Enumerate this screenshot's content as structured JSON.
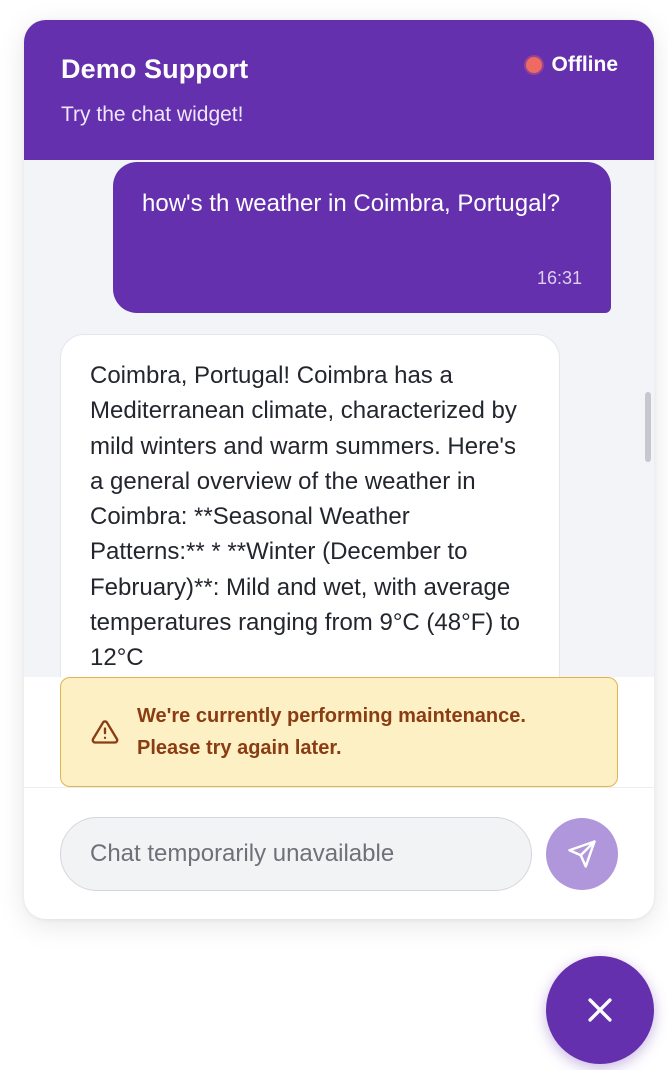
{
  "header": {
    "title": "Demo Support",
    "subtitle": "Try the chat widget!",
    "status": "Offline",
    "status_color": "#ee6a63"
  },
  "messages": [
    {
      "sender": "user",
      "text": "how's th weather in Coimbra, Portugal?",
      "time": "16:31"
    },
    {
      "sender": "bot",
      "text": "Coimbra, Portugal! Coimbra has a Mediterranean climate, characterized by mild winters and warm summers. Here's a general overview of the weather in Coimbra: **Seasonal Weather Patterns:** * **Winter (December to February)**: Mild and wet, with average temperatures ranging from 9°C (48°F) to 12°C"
    }
  ],
  "notice": {
    "icon": "warning-icon",
    "line1": "We're currently performing maintenance.",
    "line2": "Please try again later."
  },
  "composer": {
    "placeholder": "Chat temporarily unavailable",
    "send_icon": "send-icon"
  },
  "launcher": {
    "icon": "close-icon"
  },
  "colors": {
    "brand": "#6530ad",
    "send_disabled": "#b096da",
    "notice_bg": "#fdf0c4",
    "notice_border": "#e3b24f",
    "notice_text": "#8a3c12"
  }
}
